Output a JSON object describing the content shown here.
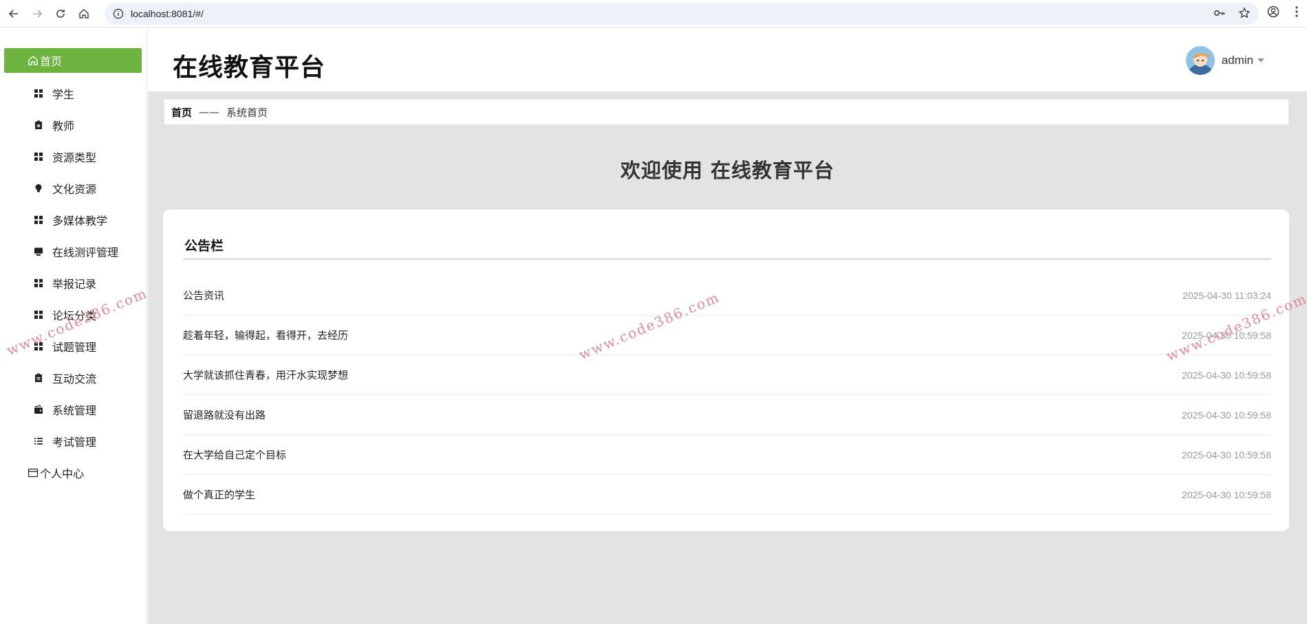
{
  "browser": {
    "url": "localhost:8081/#/"
  },
  "sidebar": {
    "items": [
      {
        "label": "首页",
        "icon": "home-icon",
        "type": "top",
        "active": true
      },
      {
        "label": "学生",
        "icon": "grid-icon",
        "type": "sub"
      },
      {
        "label": "教师",
        "icon": "clipboard-x-icon",
        "type": "sub"
      },
      {
        "label": "资源类型",
        "icon": "grid-icon",
        "type": "sub"
      },
      {
        "label": "文化资源",
        "icon": "lightbulb-icon",
        "type": "sub"
      },
      {
        "label": "多媒体教学",
        "icon": "grid-icon",
        "type": "sub"
      },
      {
        "label": "在线测评管理",
        "icon": "monitor-icon",
        "type": "sub"
      },
      {
        "label": "举报记录",
        "icon": "grid-icon",
        "type": "sub"
      },
      {
        "label": "论坛分类",
        "icon": "grid-icon",
        "type": "sub"
      },
      {
        "label": "试题管理",
        "icon": "grid-icon",
        "type": "sub"
      },
      {
        "label": "互动交流",
        "icon": "clipboard-icon",
        "type": "sub"
      },
      {
        "label": "系统管理",
        "icon": "wallet-icon",
        "type": "sub"
      },
      {
        "label": "考试管理",
        "icon": "list-icon",
        "type": "sub"
      },
      {
        "label": "个人中心",
        "icon": "card-icon",
        "type": "top"
      }
    ]
  },
  "header": {
    "title": "在线教育平台",
    "username": "admin"
  },
  "breadcrumb": {
    "home": "首页",
    "separator": "——",
    "current": "系统首页"
  },
  "welcome": "欢迎使用 在线教育平台",
  "notice_board": {
    "title": "公告栏",
    "items": [
      {
        "title": "公告资讯",
        "date": "2025-04-30 11:03:24"
      },
      {
        "title": "趁着年轻，输得起，看得开，去经历",
        "date": "2025-04-30 10:59:58"
      },
      {
        "title": "大学就该抓住青春，用汗水实现梦想",
        "date": "2025-04-30 10:59:58"
      },
      {
        "title": "留退路就没有出路",
        "date": "2025-04-30 10:59:58"
      },
      {
        "title": "在大学给自己定个目标",
        "date": "2025-04-30 10:59:58"
      },
      {
        "title": "做个真正的学生",
        "date": "2025-04-30 10:59:58"
      }
    ]
  },
  "watermark": "www.code386.com",
  "colors": {
    "accent": "#6cb33f",
    "main_bg": "#e3e3e3",
    "watermark": "#e07d8d"
  }
}
